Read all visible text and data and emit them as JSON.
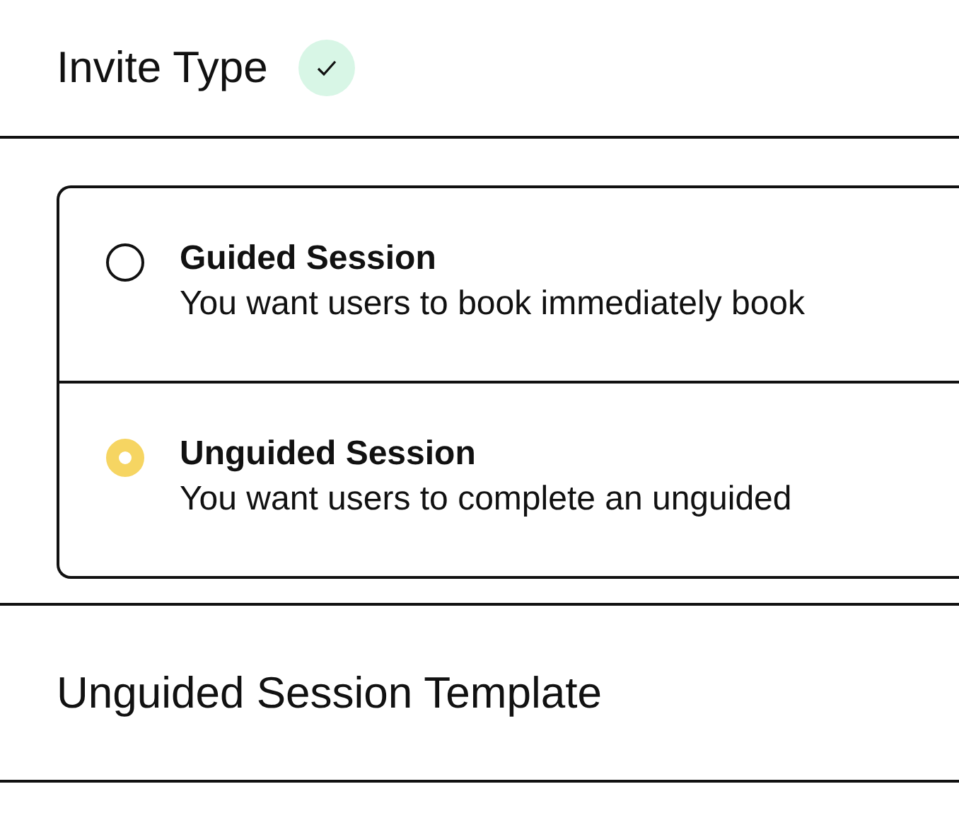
{
  "invite_type": {
    "title": "Invite Type",
    "complete": true
  },
  "options": [
    {
      "title": "Guided Session",
      "description": "You want users to book immediately book",
      "selected": false
    },
    {
      "title": "Unguided Session",
      "description": "You want users to complete an unguided",
      "selected": true
    }
  ],
  "template_section": {
    "title": "Unguided Session Template"
  }
}
